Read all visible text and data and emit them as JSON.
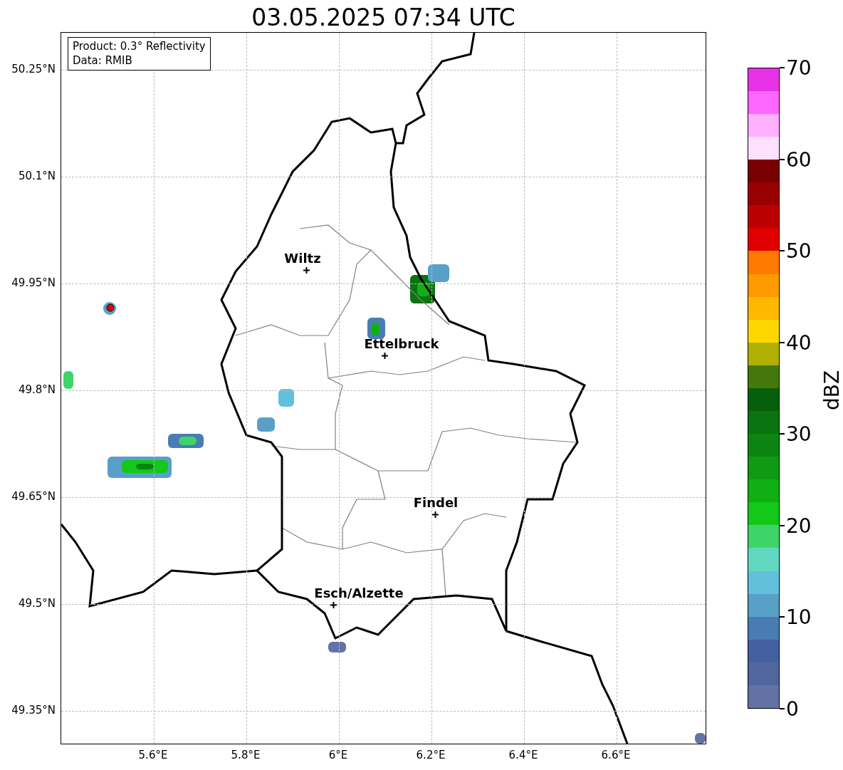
{
  "title": "03.05.2025 07:34 UTC",
  "info_box": [
    "Product: 0.3° Reflectivity",
    "Data: RMIB"
  ],
  "lat_ticks": [
    "50.25°N",
    "50.1°N",
    "49.95°N",
    "49.8°N",
    "49.65°N",
    "49.5°N",
    "49.35°N"
  ],
  "lon_ticks": [
    "5.6°E",
    "5.8°E",
    "6°E",
    "6.2°E",
    "6.4°E",
    "6.6°E"
  ],
  "cities": [
    {
      "name": "Wiltz"
    },
    {
      "name": "Ettelbruck"
    },
    {
      "name": "Findel"
    },
    {
      "name": "Esch/Alzette"
    }
  ],
  "colorbar": {
    "label": "dBZ",
    "ticks": [
      "70",
      "60",
      "50",
      "40",
      "30",
      "20",
      "10",
      "0"
    ],
    "segments": [
      {
        "color": "#6272a4"
      },
      {
        "color": "#50669c"
      },
      {
        "color": "#4460a0"
      },
      {
        "color": "#4a7cb4"
      },
      {
        "color": "#58a0c8"
      },
      {
        "color": "#62c0dc"
      },
      {
        "color": "#60d8c0"
      },
      {
        "color": "#3ed46a"
      },
      {
        "color": "#12c818"
      },
      {
        "color": "#10b014"
      },
      {
        "color": "#0e9a12"
      },
      {
        "color": "#0c8412"
      },
      {
        "color": "#0a7410"
      },
      {
        "color": "#065f0a"
      },
      {
        "color": "#45780c"
      },
      {
        "color": "#b0b000"
      },
      {
        "color": "#ffd700"
      },
      {
        "color": "#ffb800"
      },
      {
        "color": "#ff9a00"
      },
      {
        "color": "#ff7a00"
      },
      {
        "color": "#e00000"
      },
      {
        "color": "#bb0000"
      },
      {
        "color": "#990000"
      },
      {
        "color": "#780000"
      },
      {
        "color": "#ffe0ff"
      },
      {
        "color": "#ffb0ff"
      },
      {
        "color": "#ff66ff"
      },
      {
        "color": "#e832e8"
      }
    ]
  }
}
